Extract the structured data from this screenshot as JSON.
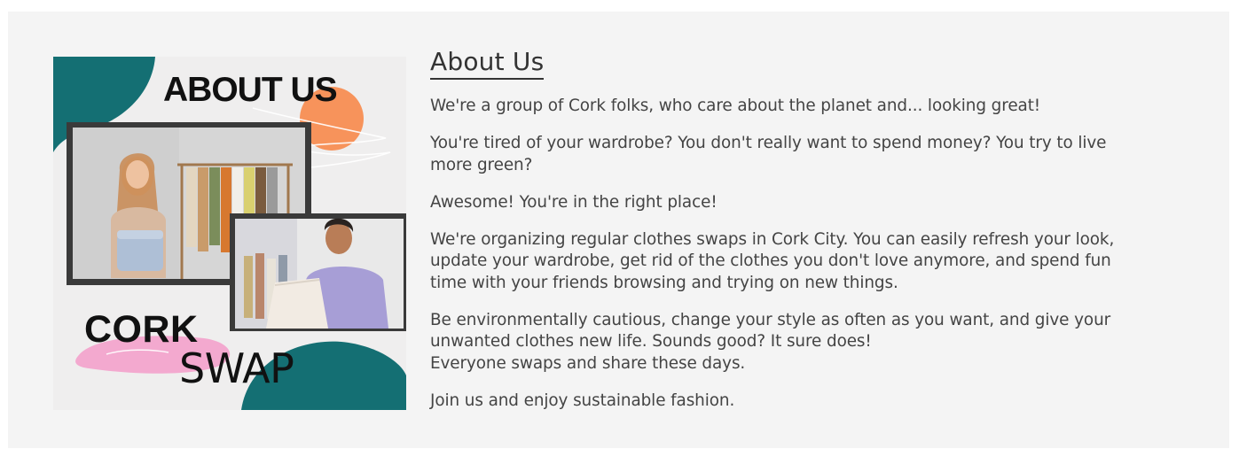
{
  "about": {
    "title": "About Us",
    "image": {
      "heading": "ABOUT US",
      "brand_top": "CORK",
      "brand_bottom": "SWAP",
      "colors": {
        "teal": "#146f73",
        "orange": "#f7935b",
        "pink": "#f3a9cf",
        "frame": "#3a3a3a"
      }
    },
    "paragraphs": [
      {
        "lines": [
          "We're a group of Cork folks, who care about the planet and... looking great!"
        ]
      },
      {
        "lines": [
          "You're tired of your wardrobe? You don't really want to spend money? You try to live",
          "more green?"
        ]
      },
      {
        "lines": [
          "Awesome! You're in the right place!"
        ]
      },
      {
        "lines": [
          "We're organizing regular clothes swaps in Cork City. You can easily refresh your look,",
          "update your wardrobe, get rid of the clothes you don't love anymore, and spend fun",
          "time with your friends browsing and trying on new things."
        ]
      },
      {
        "lines": [
          "Be environmentally cautious, change your style as often as you want, and give your",
          "unwanted clothes new life. Sounds good? It sure does!",
          "Everyone swaps and share these days."
        ]
      },
      {
        "lines": [
          "Join us and enjoy sustainable fashion."
        ]
      }
    ]
  }
}
